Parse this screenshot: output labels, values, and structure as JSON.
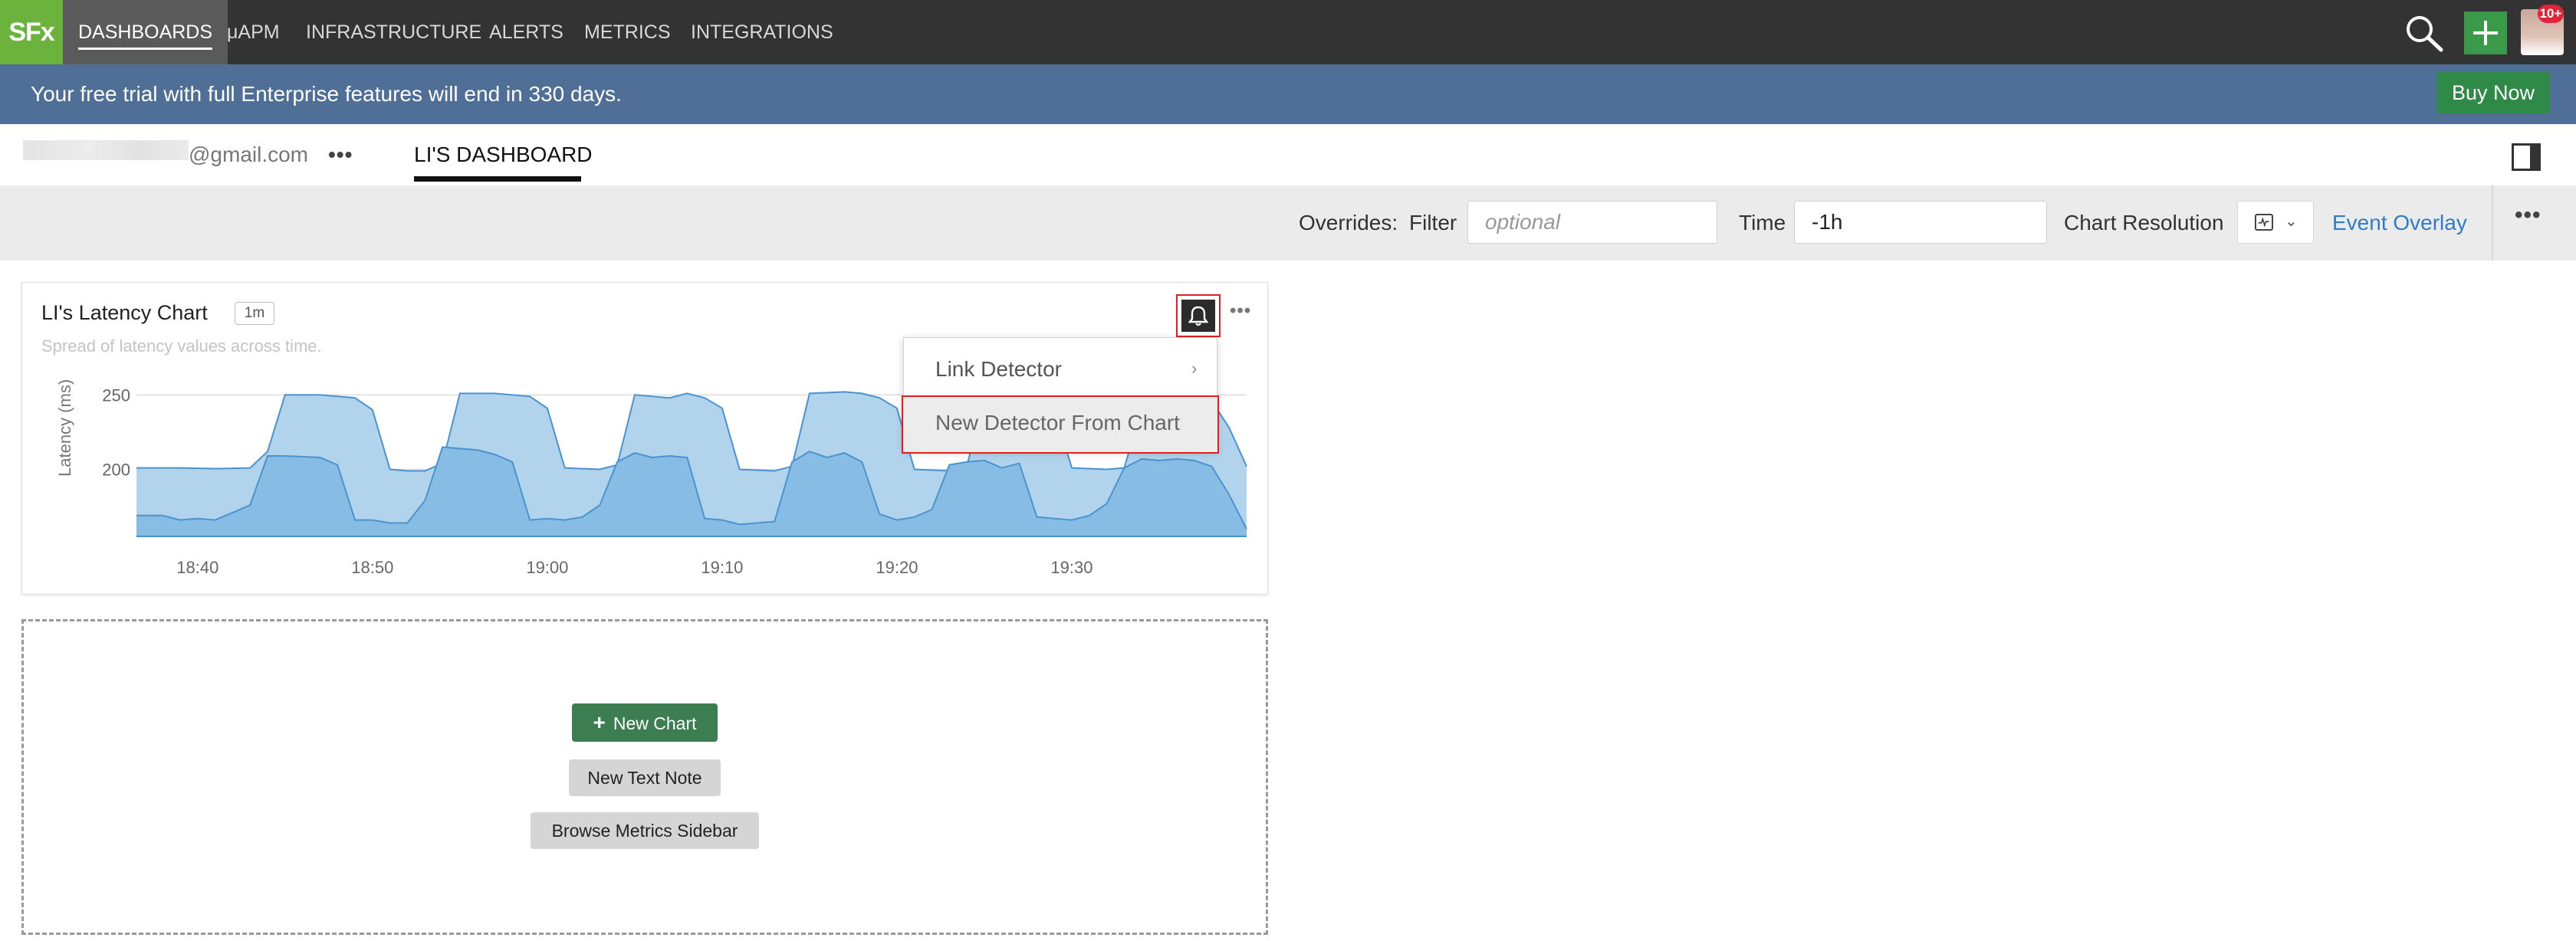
{
  "nav": {
    "logo": "SFx",
    "tabs": [
      {
        "label": "DASHBOARDS",
        "active": true
      },
      {
        "label": "μAPM"
      },
      {
        "label": "INFRASTRUCTURE"
      },
      {
        "label": "ALERTS"
      },
      {
        "label": "METRICS"
      },
      {
        "label": "INTEGRATIONS"
      }
    ],
    "notification_count": "10+"
  },
  "banner": {
    "text": "Your free trial with full Enterprise features will end in 330 days.",
    "buy_label": "Buy Now"
  },
  "dashboard": {
    "owner_email_suffix": "@gmail.com",
    "more_label": "•••",
    "tab_label": "LI'S DASHBOARD"
  },
  "overrides": {
    "label": "Overrides:",
    "filter_label": "Filter",
    "filter_placeholder": "optional",
    "time_label": "Time",
    "time_value": "-1h",
    "chart_resolution_label": "Chart Resolution",
    "event_overlay_label": "Event Overlay",
    "more_label": "•••"
  },
  "chart_card": {
    "title": "LI's Latency Chart",
    "resolution_badge": "1m",
    "subtitle": "Spread of latency values across time.",
    "more_label": "•••",
    "alert_menu": {
      "items": [
        {
          "label": "Link Detector",
          "submenu": true
        },
        {
          "label": "New Detector From Chart",
          "highlighted": true
        }
      ]
    }
  },
  "chart_data": {
    "type": "area",
    "title": "LI's Latency Chart",
    "ylabel": "Latency (ms)",
    "xlabel": "",
    "x_ticks": [
      "18:40",
      "18:50",
      "19:00",
      "19:10",
      "19:20",
      "19:30"
    ],
    "y_ticks": [
      250,
      200
    ],
    "ylim": [
      155,
      262
    ],
    "x_range_minutes": [
      -3.5,
      60
    ],
    "colors": {
      "upper_band": "#b1d3ec",
      "lower_band": "#87bde5",
      "line": "#4a93cf"
    },
    "series": [
      {
        "values": [
          [
            -3.5,
            201
          ],
          [
            -1,
            201
          ],
          [
            1,
            200.5
          ],
          [
            3,
            201
          ],
          [
            4,
            212
          ],
          [
            5,
            250
          ],
          [
            7,
            250
          ],
          [
            9,
            248
          ],
          [
            10,
            240
          ],
          [
            11,
            200
          ],
          [
            12,
            199
          ],
          [
            13,
            199
          ],
          [
            14,
            204
          ],
          [
            15,
            251
          ],
          [
            17,
            251
          ],
          [
            19,
            249
          ],
          [
            20,
            241
          ],
          [
            21,
            201
          ],
          [
            23,
            200
          ],
          [
            24,
            203
          ],
          [
            25,
            250
          ],
          [
            27,
            248
          ],
          [
            28,
            251
          ],
          [
            29,
            248
          ],
          [
            30,
            241
          ],
          [
            31,
            200
          ],
          [
            33,
            199
          ],
          [
            34,
            202
          ],
          [
            35,
            251
          ],
          [
            37,
            252
          ],
          [
            38,
            251
          ],
          [
            39,
            248
          ],
          [
            40,
            241
          ],
          [
            41,
            200
          ],
          [
            43,
            199
          ],
          [
            44,
            202
          ],
          [
            45,
            250
          ],
          [
            47,
            249
          ],
          [
            48,
            248
          ],
          [
            49,
            240
          ],
          [
            50,
            201
          ],
          [
            52,
            200
          ],
          [
            53,
            201
          ],
          [
            54,
            241
          ],
          [
            55,
            248
          ],
          [
            57,
            248
          ],
          [
            58,
            246
          ],
          [
            59,
            228
          ],
          [
            60,
            202
          ]
        ]
      },
      {
        "values": [
          [
            -3.5,
            169
          ],
          [
            -2,
            169
          ],
          [
            -1,
            166
          ],
          [
            0,
            167
          ],
          [
            1,
            166
          ],
          [
            2,
            171
          ],
          [
            3,
            176
          ],
          [
            4,
            209
          ],
          [
            5,
            209
          ],
          [
            7,
            208
          ],
          [
            8,
            203
          ],
          [
            9,
            166
          ],
          [
            10,
            166
          ],
          [
            11,
            164
          ],
          [
            12,
            164
          ],
          [
            13,
            179
          ],
          [
            14,
            215
          ],
          [
            16,
            213
          ],
          [
            17,
            210
          ],
          [
            18,
            205
          ],
          [
            19,
            166
          ],
          [
            20,
            167
          ],
          [
            21,
            166
          ],
          [
            22,
            168
          ],
          [
            23,
            176
          ],
          [
            24,
            205
          ],
          [
            25,
            211
          ],
          [
            26,
            208
          ],
          [
            27,
            209
          ],
          [
            28,
            208
          ],
          [
            29,
            167
          ],
          [
            30,
            166
          ],
          [
            31,
            163
          ],
          [
            33,
            165
          ],
          [
            34,
            205
          ],
          [
            35,
            212
          ],
          [
            36,
            208
          ],
          [
            37,
            211
          ],
          [
            38,
            205
          ],
          [
            39,
            170
          ],
          [
            40,
            166
          ],
          [
            41,
            168
          ],
          [
            42,
            173
          ],
          [
            43,
            203
          ],
          [
            44,
            205
          ],
          [
            45,
            206
          ],
          [
            46,
            201
          ],
          [
            47,
            204
          ],
          [
            48,
            168
          ],
          [
            49,
            167
          ],
          [
            50,
            166
          ],
          [
            51,
            169
          ],
          [
            52,
            177
          ],
          [
            53,
            201
          ],
          [
            54,
            207
          ],
          [
            55,
            206
          ],
          [
            56,
            207
          ],
          [
            57,
            206
          ],
          [
            58,
            202
          ],
          [
            59,
            183
          ],
          [
            60,
            160
          ]
        ]
      }
    ]
  },
  "placeholder": {
    "new_chart_label": "New Chart",
    "new_text_note_label": "New Text Note",
    "browse_metrics_label": "Browse Metrics Sidebar"
  }
}
